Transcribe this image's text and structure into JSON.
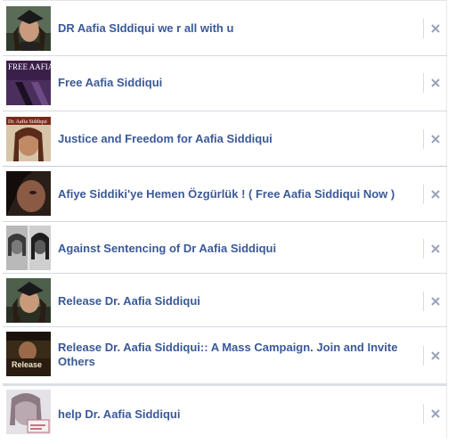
{
  "suggestions": [
    {
      "title": "DR Aafia SIddiqui we r all with u",
      "remove_icon": "close-icon"
    },
    {
      "title": "Free Aafia Siddiqui",
      "thumb_text": "FREE AAFIA SIDDIQUI",
      "remove_icon": "close-icon"
    },
    {
      "title": "Justice and Freedom for Aafia Siddiqui",
      "thumb_text": "Dr. Aafia Siddiqui",
      "remove_icon": "close-icon"
    },
    {
      "title": "Afiye Siddiki'ye Hemen Özgürlük ! ( Free Aafia Siddiqui Now )",
      "remove_icon": "close-icon"
    },
    {
      "title": "Against Sentencing of Dr Aafia Siddiqui",
      "remove_icon": "close-icon"
    },
    {
      "title": "Release Dr. Aafia Siddiqui",
      "remove_icon": "close-icon"
    },
    {
      "title": "Release Dr. Aafia Siddiqui:: A Mass Campaign. Join and Invite Others",
      "thumb_text": "Release",
      "remove_icon": "close-icon"
    },
    {
      "title": "help Dr. Aafia Siddiqui",
      "remove_icon": "close-icon"
    }
  ],
  "colors": {
    "link": "#3b5998",
    "border": "#d6d9e0",
    "close_icon": "#9aa3b8"
  }
}
